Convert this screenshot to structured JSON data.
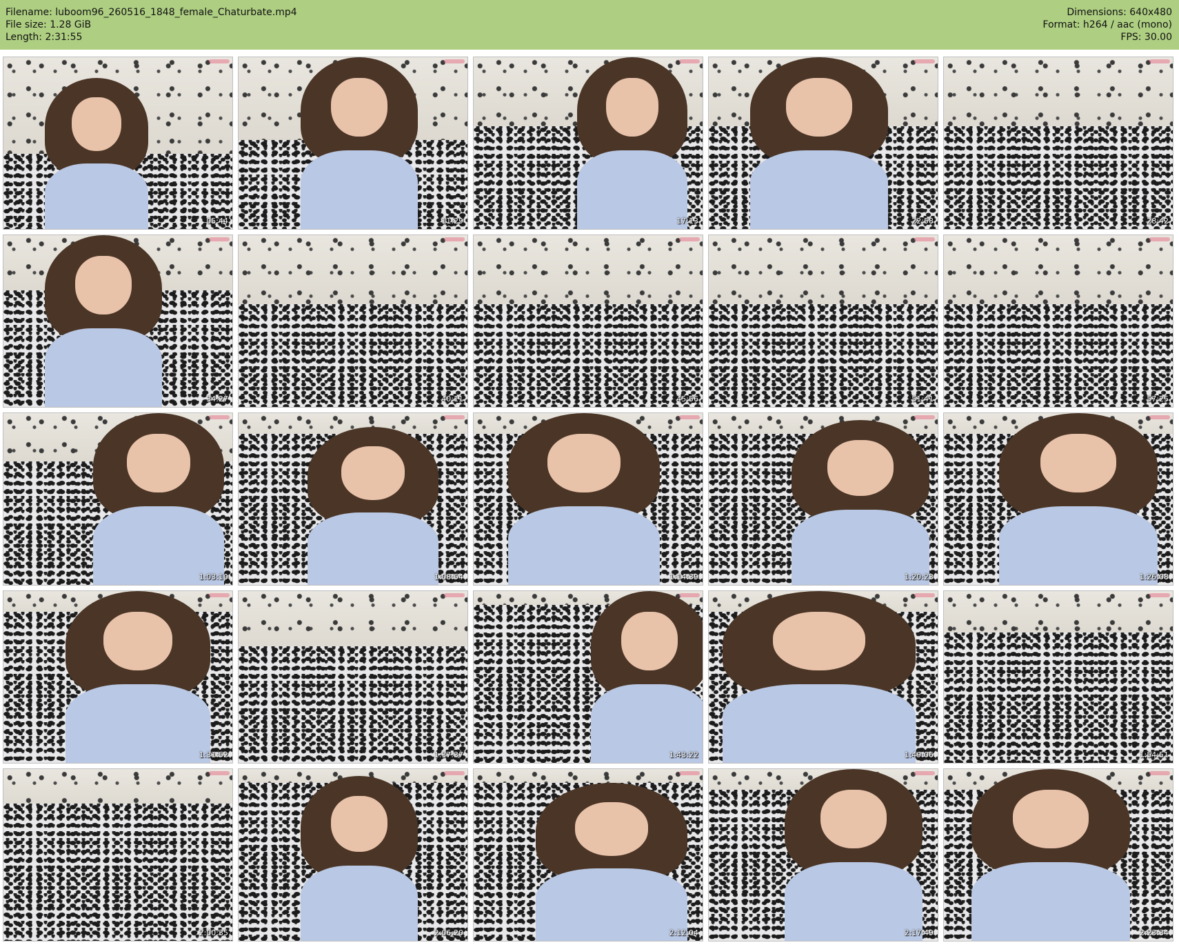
{
  "header": {
    "filename": "Filename: luboom96_260516_1848_female_Chaturbate.mp4",
    "filesize": "File size: 1.28 GiB",
    "length": "Length: 2:31:55",
    "dimensions": "Dimensions: 640x480",
    "format": "Format: h264 / aac (mono)",
    "fps": "FPS: 30.00",
    "bg_color": "#aece82"
  },
  "thumbnails": [
    {
      "time": "05:44",
      "person": true
    },
    {
      "time": "11:29",
      "person": true
    },
    {
      "time": "17:13",
      "person": true
    },
    {
      "time": "22:58",
      "person": true
    },
    {
      "time": "28:42",
      "person": false
    },
    {
      "time": "34:27",
      "person": true
    },
    {
      "time": "40:11",
      "person": false
    },
    {
      "time": "45:56",
      "person": false
    },
    {
      "time": "51:41",
      "person": false
    },
    {
      "time": "57:25",
      "person": false
    },
    {
      "time": "1:03:10",
      "person": true
    },
    {
      "time": "1:08:54",
      "person": true
    },
    {
      "time": "1:14:39",
      "person": true
    },
    {
      "time": "1:20:23",
      "person": true
    },
    {
      "time": "1:26:08",
      "person": true
    },
    {
      "time": "1:31:52",
      "person": true
    },
    {
      "time": "1:37:37",
      "person": false
    },
    {
      "time": "1:43:22",
      "person": true
    },
    {
      "time": "1:49:06",
      "person": true
    },
    {
      "time": "1:54:51",
      "person": false
    },
    {
      "time": "2:00:35",
      "person": false
    },
    {
      "time": "2:06:20",
      "person": true
    },
    {
      "time": "2:12:04",
      "person": true
    },
    {
      "time": "2:17:49",
      "person": true
    },
    {
      "time": "2:23:34",
      "person": true
    }
  ]
}
